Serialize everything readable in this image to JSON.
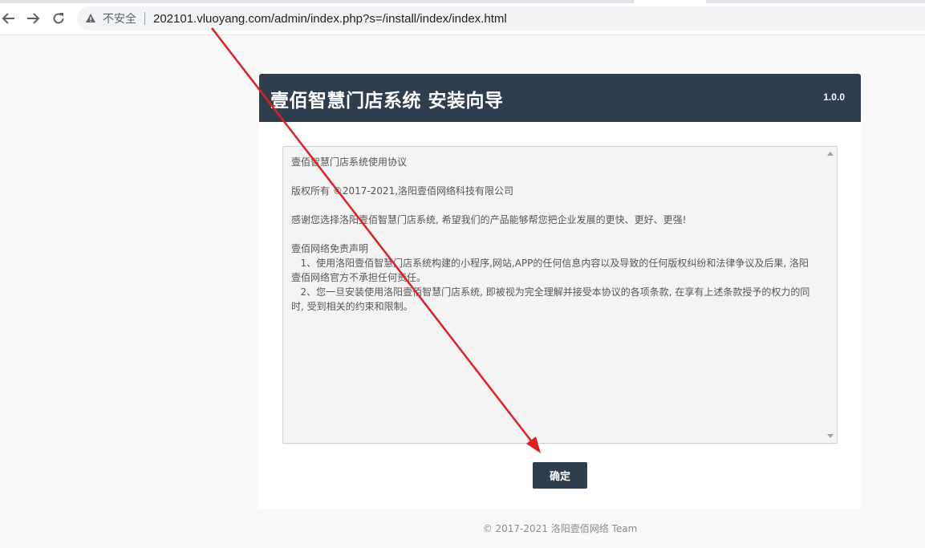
{
  "browser": {
    "security_label": "不安全",
    "url": "202101.vluoyang.com/admin/index.php?s=/install/index/index.html"
  },
  "header": {
    "title": "壹佰智慧门店系统 安装向导",
    "version": "1.0.0"
  },
  "agreement": {
    "text": "壹佰智慧门店系统使用协议\n\n版权所有 ©2017-2021,洛阳壹佰网络科技有限公司\n\n感谢您选择洛阳壹佰智慧门店系统, 希望我们的产品能够帮您把企业发展的更快、更好、更强!\n\n壹佰网络免责声明\n   1、使用洛阳壹佰智慧门店系统构建的小程序,网站,APP的任何信息内容以及导致的任何版权纠纷和法律争议及后果, 洛阳壹佰网络官方不承担任何责任。\n   2、您一旦安装使用洛阳壹佰智慧门店系统, 即被视为完全理解并接受本协议的各项条款, 在享有上述条款授予的权力的同时, 受到相关的约束和限制。"
  },
  "confirm_label": "确定",
  "footer": "© 2017-2021 洛阳壹佰网络 Team",
  "colors": {
    "header_bg": "#2f3e4e",
    "annotation": "#e02020"
  }
}
